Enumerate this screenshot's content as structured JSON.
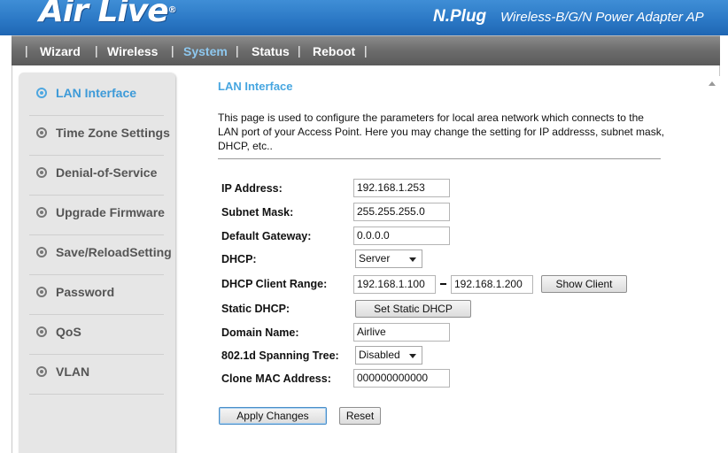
{
  "header": {
    "logo": "Air Live",
    "logo_mark": "®",
    "product": "N.Plug",
    "product_desc": "Wireless-B/G/N Power Adapter AP"
  },
  "nav": {
    "items": [
      {
        "label": "Wizard"
      },
      {
        "label": "Wireless"
      },
      {
        "label": "System"
      },
      {
        "label": "Status"
      },
      {
        "label": "Reboot"
      }
    ],
    "active": "System"
  },
  "sidebar": {
    "items": [
      {
        "label": "LAN Interface"
      },
      {
        "label": "Time Zone Settings"
      },
      {
        "label": "Denial-of-Service"
      },
      {
        "label": "Upgrade Firmware"
      },
      {
        "label": "Save/ReloadSetting"
      },
      {
        "label": "Password"
      },
      {
        "label": "QoS"
      },
      {
        "label": "VLAN"
      }
    ],
    "active": "LAN Interface"
  },
  "main": {
    "title": "LAN Interface",
    "description": "This page is used to configure the parameters for local area network which connects to the LAN port of your Access Point. Here you may change the setting for IP addresss, subnet mask, DHCP, etc..",
    "form": {
      "ip_address": {
        "label": "IP Address:",
        "value": "192.168.1.253"
      },
      "subnet_mask": {
        "label": "Subnet Mask:",
        "value": "255.255.255.0"
      },
      "default_gateway": {
        "label": "Default Gateway:",
        "value": "0.0.0.0"
      },
      "dhcp": {
        "label": "DHCP:",
        "value": "Server"
      },
      "dhcp_range": {
        "label": "DHCP Client Range:",
        "start": "192.168.1.100",
        "end": "192.168.1.200",
        "button": "Show Client"
      },
      "static_dhcp": {
        "label": "Static DHCP:",
        "button": "Set Static DHCP"
      },
      "domain_name": {
        "label": "Domain Name:",
        "value": "Airlive"
      },
      "spanning_tree": {
        "label": "802.1d Spanning Tree:",
        "value": "Disabled"
      },
      "clone_mac": {
        "label": "Clone MAC Address:",
        "value": "000000000000"
      }
    },
    "buttons": {
      "apply": "Apply Changes",
      "reset": "Reset"
    }
  },
  "colors": {
    "header_blue": "#2a77c4",
    "nav_gray": "#6b6b6b",
    "accent": "#47a6e0",
    "sidebar_bg": "#e6e6e6"
  }
}
